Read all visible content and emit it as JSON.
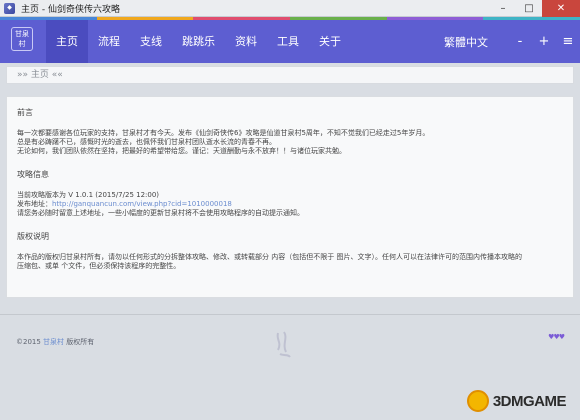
{
  "window": {
    "title": "主页 - 仙剑奇侠传六攻略",
    "controls": {
      "minimize": "–",
      "maximize": "□",
      "close": "✕"
    }
  },
  "header": {
    "logo_text": "甘泉村",
    "nav": [
      "主页",
      "流程",
      "支线",
      "跳跳乐",
      "资料",
      "工具",
      "关于"
    ],
    "language": "繁體中文",
    "minimize_btn": "-",
    "add_btn": "+",
    "menu_btn": "≡",
    "stripe_colors": [
      "#4a87d8",
      "#f0a81f",
      "#e04e6f",
      "#6ab04c",
      "#8e5ed6",
      "#3fb4c6"
    ],
    "accent": "#5d5ed1"
  },
  "breadcrumb": "»» 主页 ««",
  "content": {
    "preface": {
      "title": "前言",
      "lines": [
        "每一次都要感谢各位玩家的支持，甘泉村才有今天。发布《仙剑奇侠传6》攻略是仙道甘泉村5周年，不知不觉我们已经走过5年岁月。",
        "总是有必踌躇不已，感慨时光的逝去，也佩怀我们甘泉村团队逝水长流的青春不再。",
        "无论如何，我们团队依然在坚持，把最好的希望带给您。谨记：天道酬勤与永不放弃！！与诸位玩家共勉。"
      ]
    },
    "guide": {
      "title": "攻略信息",
      "version_line": "当前攻略版本为 V 1.0.1 (2015/7/25 12:00)",
      "address_label": "发布地址：",
      "address_link": "http://ganquancun.com/view.php?cid=1010000018",
      "note": "请您务必随时留意上述地址，一些小幅度的更新甘泉村将不会使用攻略程序的自动提示通知。"
    },
    "copyright": {
      "title": "版权说明",
      "lines": [
        "本作品的版权归甘泉村所有，请勿以任何形式的分拆整体攻略、修改、或转载部分 内容（包括但不限于 图片、文字）。任何人可以在法律许可的范围内传播本攻略的",
        "压缩包、或单 个文件，但必须保持该程序的完整性。"
      ]
    }
  },
  "footer": {
    "copyright_prefix": "©2015 ",
    "copyright_link": "甘泉村",
    "copyright_suffix": " 版权所有",
    "right_icon": "♥♥♥",
    "watermark": "3DMGAME"
  }
}
